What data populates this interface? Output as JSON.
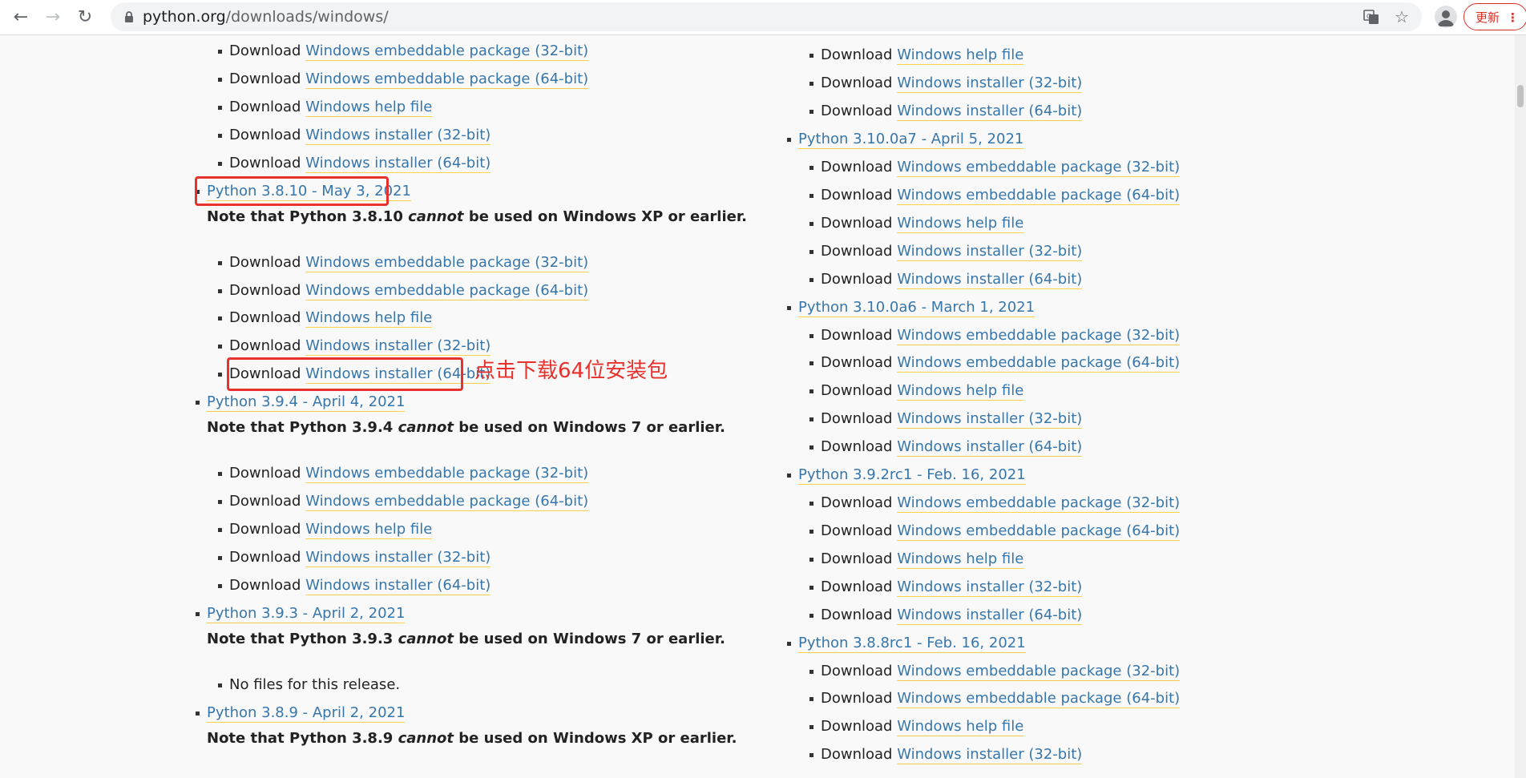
{
  "browser": {
    "url_host": "python.org",
    "url_path": "/downloads/windows/",
    "update_label": "更新",
    "menu_dots": "⋮"
  },
  "strings": {
    "download": "Download",
    "embed32": "Windows embeddable package (32-bit)",
    "embed64": "Windows embeddable package (64-bit)",
    "help": "Windows help file",
    "inst32": "Windows installer (32-bit)",
    "inst64": "Windows installer (64-bit)"
  },
  "left": {
    "releases": [
      {
        "title": "Python 3.8.10 - May 3, 2021",
        "note_pre": "Note that Python 3.8.10 ",
        "note_em": "cannot",
        "note_post": " be used on Windows XP or earlier."
      },
      {
        "title": "Python 3.9.4 - April 4, 2021",
        "note_pre": "Note that Python 3.9.4 ",
        "note_em": "cannot",
        "note_post": " be used on Windows 7 or earlier."
      },
      {
        "title": "Python 3.9.3 - April 2, 2021",
        "note_pre": "Note that Python 3.9.3 ",
        "note_em": "cannot",
        "note_post": " be used on Windows 7 or earlier.",
        "no_files": "No files for this release."
      },
      {
        "title": "Python 3.8.9 - April 2, 2021",
        "note_pre": "Note that Python 3.8.9 ",
        "note_em": "cannot",
        "note_post": " be used on Windows XP or earlier."
      }
    ]
  },
  "right": {
    "releases": [
      {
        "title": "Python 3.10.0a7 - April 5, 2021"
      },
      {
        "title": "Python 3.10.0a6 - March 1, 2021"
      },
      {
        "title": "Python 3.9.2rc1 - Feb. 16, 2021"
      },
      {
        "title": "Python 3.8.8rc1 - Feb. 16, 2021"
      }
    ]
  },
  "annotation": {
    "text": "点击下载64位安装包",
    "color": "#e8312c"
  },
  "colors": {
    "link": "#3776ab",
    "link_underline": "#ffd343"
  }
}
